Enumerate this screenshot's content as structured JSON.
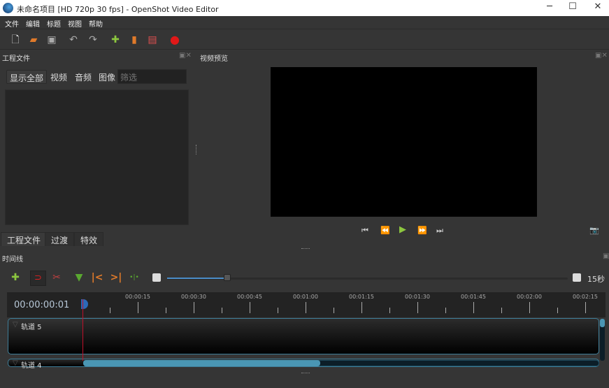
{
  "window": {
    "title": "未命名项目 [HD 720p 30 fps] - OpenShot Video Editor",
    "minimize": "─",
    "maximize": "☐",
    "close": "✕"
  },
  "menu": [
    "文件",
    "编辑",
    "标题",
    "视图",
    "帮助"
  ],
  "toolbar": {
    "icons": [
      "new-project-icon",
      "open-project-icon",
      "save-project-icon",
      "undo-icon",
      "redo-icon",
      "import-files-icon",
      "profile-icon",
      "export-video-icon",
      "record-icon"
    ]
  },
  "project_files": {
    "title": "工程文件",
    "filters": [
      "显示全部",
      "视频",
      "音频",
      "图像"
    ],
    "filter_placeholder": "筛选",
    "tabs": [
      "工程文件",
      "过渡",
      "特效"
    ]
  },
  "preview": {
    "title": "视频预览"
  },
  "timeline": {
    "title": "时间线",
    "timecode": "00:00:00:01",
    "zoom_label": "15秒",
    "zoom_value": 0.15,
    "ruler_labels": [
      "00:00:15",
      "00:00:30",
      "00:00:45",
      "00:01:00",
      "00:01:15",
      "00:01:30",
      "00:01:45",
      "00:02:00",
      "00:02:15"
    ],
    "tracks": [
      "轨道 5",
      "轨道 4"
    ],
    "scroll_fraction": 0.46
  },
  "colors": {
    "accent": "#4a96b4",
    "playhead": "#c0102a",
    "play": "#8cc63f"
  }
}
